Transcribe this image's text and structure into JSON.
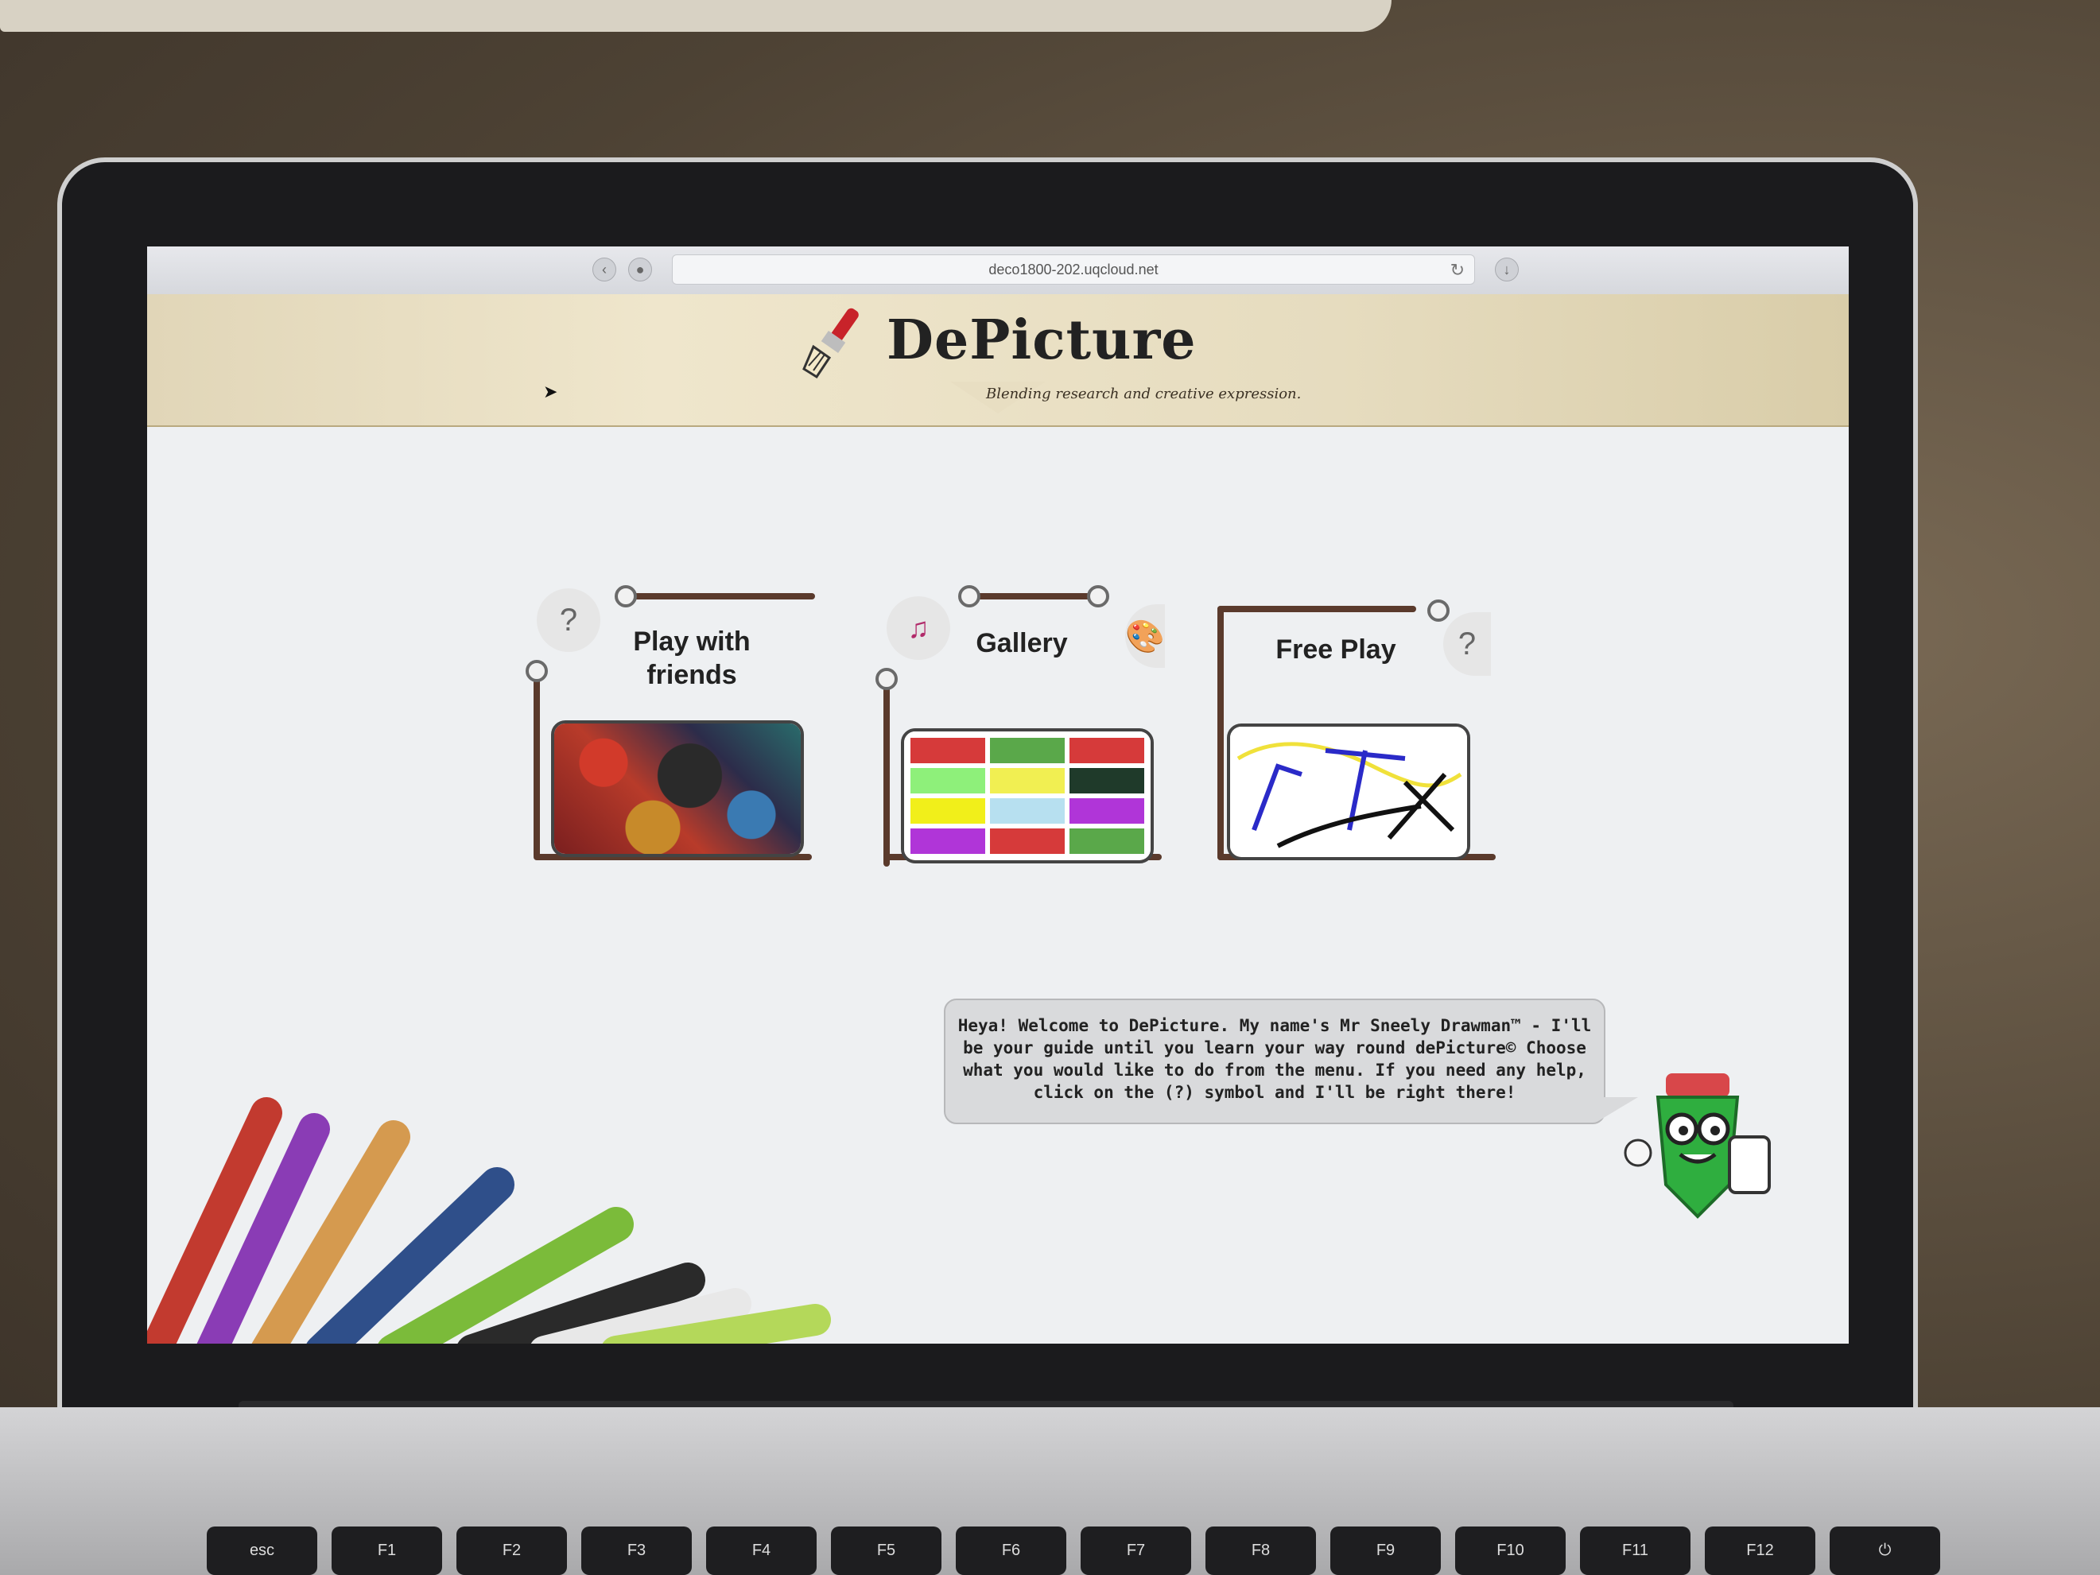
{
  "browser": {
    "url": "deco1800-202.uqcloud.net"
  },
  "header": {
    "brand": "DePicture",
    "tagline": "Blending research and creative expression."
  },
  "menu": {
    "play_with_friends": {
      "title_line1": "Play with",
      "title_line2": "friends",
      "help": "?"
    },
    "gallery": {
      "title": "Gallery"
    },
    "free_play": {
      "title": "Free Play",
      "help": "?"
    }
  },
  "gallery_colors": [
    "#d63a3a",
    "#5aa84a",
    "#d63a3a",
    "#8ef07a",
    "#f1ef52",
    "#1f3a2a",
    "#f1ef1a",
    "#b7e0f0",
    "#b035d8",
    "#b035d8",
    "#d63a3a",
    "#5aa84a"
  ],
  "guide": {
    "message": "Heya! Welcome to DePicture. My name's Mr Sneely Drawman™ - I'll be your guide until you learn your way round dePicture© Choose what you would like to do from the menu. If you need any help, click on the (?) symbol and I'll be right there!"
  },
  "keyboard": {
    "keys": [
      "esc",
      "F1",
      "F2",
      "F3",
      "F4",
      "F5",
      "F6",
      "F7",
      "F8",
      "F9",
      "F10",
      "F11",
      "F12",
      "⏻"
    ]
  },
  "colors": {
    "frame": "#5a3a2c",
    "header": "#e6dcbf"
  }
}
